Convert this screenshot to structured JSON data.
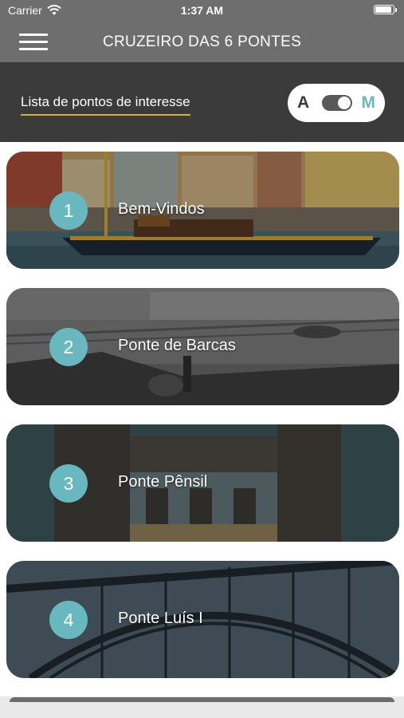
{
  "status_bar": {
    "carrier": "Carrier",
    "time": "1:37 AM",
    "battery_level": 0.95
  },
  "header": {
    "title": "CRUZEIRO DAS 6 PONTES",
    "menu_icon": "hamburger-icon"
  },
  "sub_bar": {
    "list_label": "Lista de pontos de interesse",
    "toggle": {
      "left_label": "A",
      "right_label": "M",
      "selected": "M"
    }
  },
  "colors": {
    "header_bg": "#6e6e6e",
    "sub_bar_bg": "#3b3b3b",
    "accent_underline": "#d4b13a",
    "badge": "#6ab8bf"
  },
  "points": [
    {
      "number": "1",
      "title": "Bem-Vindos"
    },
    {
      "number": "2",
      "title": "Ponte de Barcas"
    },
    {
      "number": "3",
      "title": "Ponte Pênsil"
    },
    {
      "number": "4",
      "title": "Ponte Luís I"
    }
  ]
}
